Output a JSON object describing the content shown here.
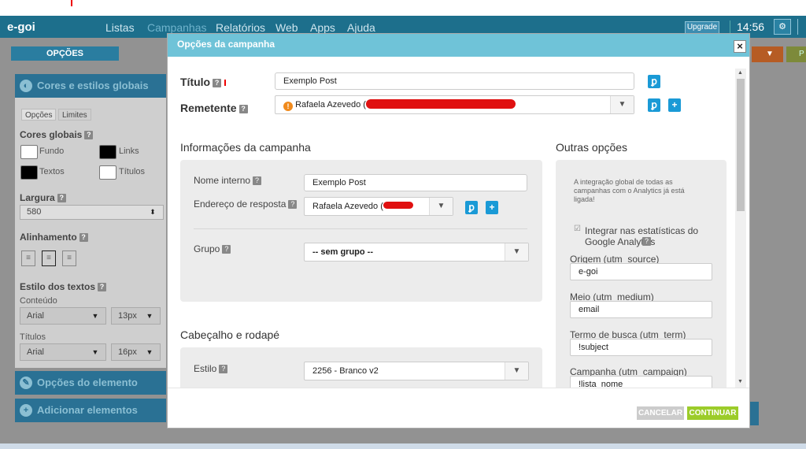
{
  "topbar": {
    "logo": "e-goi",
    "nav": [
      "Listas",
      "Campanhas",
      "Relatórios",
      "Web",
      "Apps",
      "Ajuda"
    ],
    "active_nav": "Campanhas",
    "upgrade": "Upgrade",
    "clock": "14:56"
  },
  "toolbar": {
    "opcoes": "OPÇÕES",
    "right_btn": "P"
  },
  "sidebar": {
    "global_title": "Cores e estilos globais",
    "tabs": [
      "Opções",
      "Limites"
    ],
    "cores_globais": "Cores globais",
    "fundo": "Fundo",
    "links": "Links",
    "textos": "Textos",
    "titulos": "Títulos",
    "largura": "Largura",
    "largura_value": "580",
    "alinhamento": "Alinhamento",
    "estilo_textos": "Estilo dos textos",
    "conteudo": "Conteúdo",
    "font1": "Arial",
    "size1": "13px",
    "titulos_label": "Títulos",
    "font2": "Arial",
    "size2": "16px",
    "opcoes_elemento": "Opções do elemento",
    "adicionar_elementos": "Adicionar elementos"
  },
  "modal": {
    "title": "Opções da campanha",
    "close": "×",
    "titulo_label": "Título",
    "titulo_value": "Exemplo Post",
    "remetente_label": "Remetente",
    "remetente_value": "Rafaela Azevedo (",
    "info_title": "Informações da campanha",
    "nome_interno_label": "Nome interno",
    "nome_interno_value": "Exemplo Post",
    "endereco_label": "Endereço de resposta",
    "endereco_value": "Rafaela Azevedo (",
    "grupo_label": "Grupo",
    "grupo_value": "-- sem grupo --",
    "cabecalho_title": "Cabeçalho e rodapé",
    "estilo_label": "Estilo",
    "estilo_value": "2256 - Branco v2",
    "outras_title": "Outras opções",
    "analytics_note": "A integração global de todas as campanhas com o Analytics já está ligada!",
    "integrar_label": "Integrar nas estatísticas do Google Analytics",
    "origem_label": "Origem (utm_source)",
    "origem_value": "e-goi",
    "meio_label": "Meio (utm_medium)",
    "meio_value": "email",
    "termo_label": "Termo de busca (utm_term)",
    "termo_value": "!subject",
    "campanha_label": "Campanha (utm_campaign)",
    "campanha_value": "!lista_nome",
    "cancel": "CANCELAR",
    "continue": "CONTINUAR"
  },
  "colors": {
    "topbar": "#1d6f8c",
    "modal_header": "#6fc3d8",
    "continue": "#9ccc2a",
    "action_blue": "#1a9ad6"
  }
}
